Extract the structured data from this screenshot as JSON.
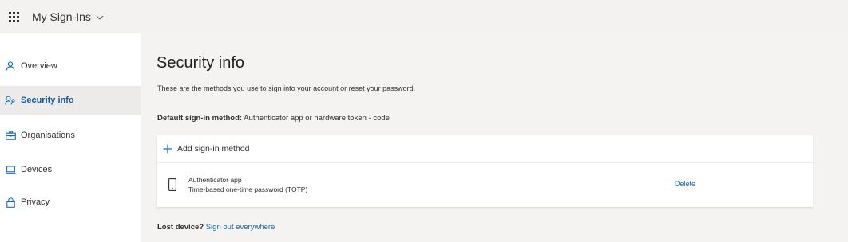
{
  "header": {
    "app_title": "My Sign-Ins",
    "app_menu_icon": "waffle-icon",
    "chevron_icon": "chevron-down-icon"
  },
  "sidebar": {
    "items": [
      {
        "label": "Overview",
        "icon": "person-icon",
        "active": false
      },
      {
        "label": "Security info",
        "icon": "security-key-person-icon",
        "active": true
      },
      {
        "label": "Organisations",
        "icon": "briefcase-icon",
        "active": false
      },
      {
        "label": "Devices",
        "icon": "laptop-icon",
        "active": false
      },
      {
        "label": "Privacy",
        "icon": "lock-icon",
        "active": false
      }
    ]
  },
  "main": {
    "title": "Security info",
    "description": "These are the methods you use to sign into your account or reset your password.",
    "default_method_label": "Default sign-in method:",
    "default_method_value": "Authenticator app or hardware token - code",
    "add_method_label": "Add sign-in method",
    "methods": [
      {
        "name": "Authenticator app",
        "detail": "Time-based one-time password (TOTP)",
        "icon": "phone-icon",
        "delete_label": "Delete"
      }
    ],
    "lost_device_label": "Lost device?",
    "sign_out_label": "Sign out everywhere"
  },
  "colors": {
    "accent": "#0f6cbd",
    "header_bg": "#f3f2f1",
    "main_bg": "#f4f3f2",
    "active_nav_bg": "#edebe9"
  }
}
